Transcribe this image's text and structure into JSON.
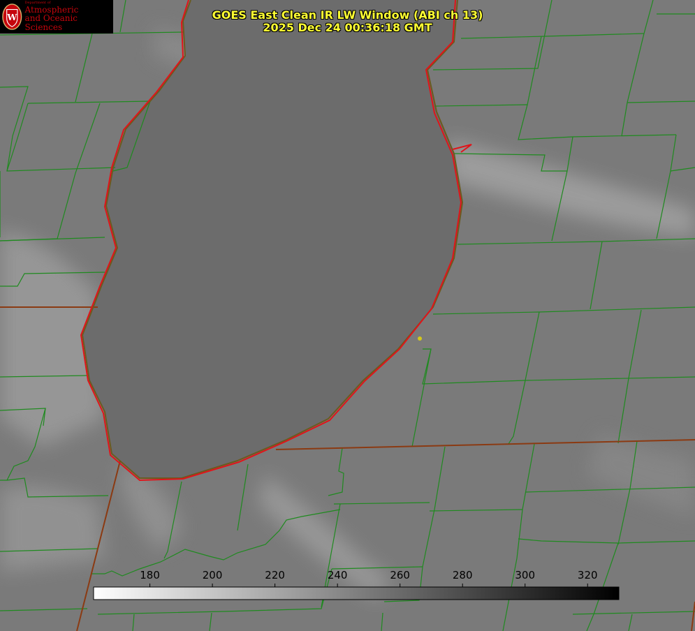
{
  "header": {
    "title": "GOES East Clean IR LW Window (ABI ch 13)",
    "timestamp": "2025 Dec 24 00:36:18 GMT"
  },
  "logo": {
    "department_small": "Department of",
    "line1": "Atmospheric",
    "line2": "and Oceanic Sciences",
    "seal_letter": "W"
  },
  "colorbar": {
    "ticks": [
      "180",
      "200",
      "220",
      "240",
      "260",
      "280",
      "300",
      "320"
    ],
    "range": [
      162,
      330
    ],
    "gradient": "white-to-black"
  },
  "colors": {
    "county_lines": "#1f8a1f",
    "state_lines": "#8b3a12",
    "shoreline_highlight": "#e0141a",
    "title_text": "#ffff33",
    "logo_red": "#c5050c",
    "marker": "#d4c81a"
  },
  "legend_labels": {
    "seal_icon": "uw-seal-icon",
    "marker_icon": "station-dot-icon"
  }
}
